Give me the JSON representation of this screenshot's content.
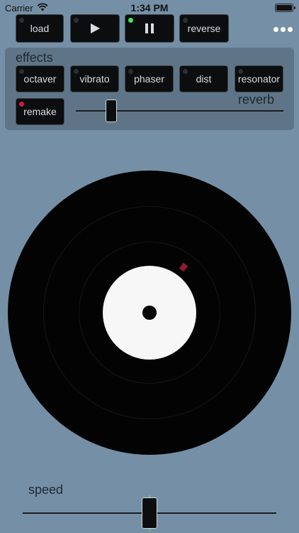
{
  "status_bar": {
    "carrier": "Carrier",
    "time": "1:34 PM"
  },
  "transport": {
    "load_label": "load",
    "play_icon": "play-icon",
    "pause_icon": "pause-icon",
    "reverse_label": "reverse",
    "pause_active": true
  },
  "more_icon": "more-icon",
  "effects": {
    "title": "effects",
    "buttons": [
      {
        "label": "octaver",
        "active": false
      },
      {
        "label": "vibrato",
        "active": false
      },
      {
        "label": "phaser",
        "active": false
      },
      {
        "label": "dist",
        "active": false
      },
      {
        "label": "resonator",
        "active": false
      }
    ],
    "remake_label": "remake",
    "remake_active": true,
    "reverb_label": "reverb",
    "reverb_level": 0.17
  },
  "speed": {
    "label": "speed",
    "level": 0.5
  },
  "colors": {
    "background": "#7590a6",
    "panel": "#5f7587",
    "led_green": "#43e85a",
    "led_red": "#d4184a",
    "record": "#030303",
    "record_label": "#f7f7f7",
    "center_line": "#5bd06a"
  }
}
